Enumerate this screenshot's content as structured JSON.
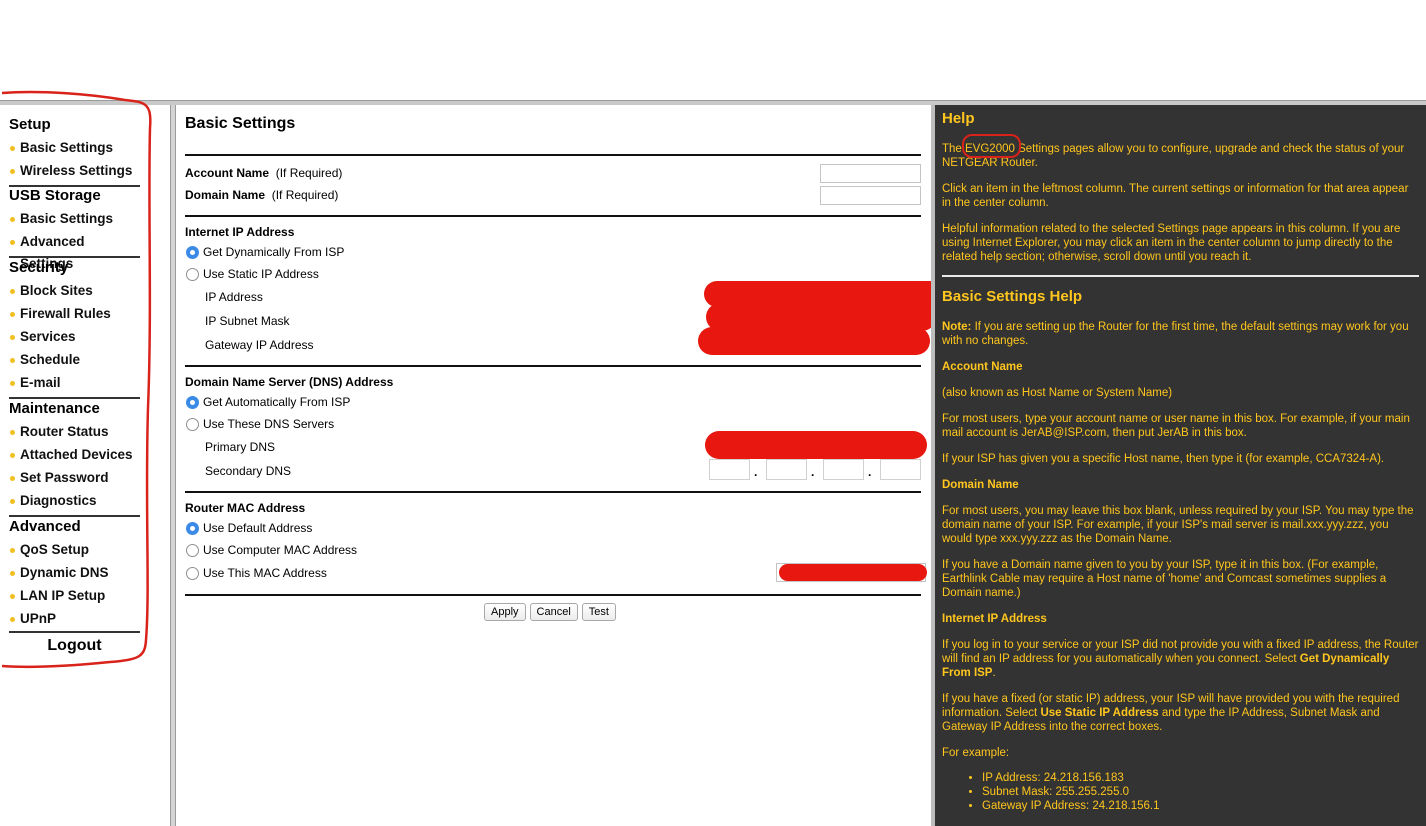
{
  "sidebar": {
    "groups": [
      {
        "heading": "Setup",
        "items": [
          "Basic Settings",
          "Wireless Settings"
        ]
      },
      {
        "heading": "USB Storage",
        "items": [
          "Basic Settings",
          "Advanced Settings"
        ]
      },
      {
        "heading": "Security",
        "items": [
          "Block Sites",
          "Firewall Rules",
          "Services",
          "Schedule",
          "E-mail"
        ]
      },
      {
        "heading": "Maintenance",
        "items": [
          "Router Status",
          "Attached Devices",
          "Set Password",
          "Diagnostics"
        ]
      },
      {
        "heading": "Advanced",
        "items": [
          "QoS Setup",
          "Dynamic DNS",
          "LAN IP Setup",
          "UPnP"
        ]
      }
    ],
    "logout": "Logout"
  },
  "main": {
    "title": "Basic Settings",
    "account_name_label": "Account Name",
    "account_name_hint": "(If Required)",
    "account_name_value": "",
    "domain_name_label": "Domain Name",
    "domain_name_hint": "(If Required)",
    "domain_name_value": "",
    "internet_ip": {
      "heading": "Internet IP Address",
      "opt_dynamic": "Get Dynamically From ISP",
      "opt_static": "Use Static IP Address",
      "ip_label": "IP Address",
      "subnet_label": "IP Subnet Mask",
      "gateway_label": "Gateway IP Address",
      "selected": "dynamic"
    },
    "dns": {
      "heading": "Domain Name Server (DNS) Address",
      "opt_auto": "Get Automatically From ISP",
      "opt_manual": "Use These DNS Servers",
      "primary_label": "Primary DNS",
      "secondary_label": "Secondary DNS",
      "separator": ".",
      "selected": "auto"
    },
    "mac": {
      "heading": "Router MAC Address",
      "opt_default": "Use Default Address",
      "opt_computer": "Use Computer MAC Address",
      "opt_this": "Use This MAC Address",
      "selected": "default"
    },
    "buttons": {
      "apply": "Apply",
      "cancel": "Cancel",
      "test": "Test"
    }
  },
  "help": {
    "title": "Help",
    "intro_pre": "The ",
    "intro_model": "EVG2000",
    "intro_post": " Settings pages allow you to configure, upgrade and check the status of your NETGEAR Router.",
    "p2": "Click an item in the leftmost column. The current settings or information for that area appear in the center column.",
    "p3": "Helpful information related to the selected Settings page appears in this column. If you are using Internet Explorer, you may click an item in the center column to jump directly to the related help section; otherwise, scroll down until you reach it.",
    "section_title": "Basic Settings Help",
    "note_label": "Note:",
    "note_text": " If you are setting up the Router for the first time, the default settings may work for you with no changes.",
    "account_heading": "Account Name",
    "account_p1": "(also known as Host Name or System Name)",
    "account_p2": "For most users, type your account name or user name in this box. For example, if your main mail account is JerAB@ISP.com, then put JerAB in this box.",
    "account_p3": "If your ISP has given you a specific Host name, then type it (for example, CCA7324-A).",
    "domain_heading": "Domain Name",
    "domain_p1": "For most users, you may leave this box blank, unless required by your ISP. You may type the domain name of your ISP. For example, if your ISP's mail server is mail.xxx.yyy.zzz, you would type xxx.yyy.zzz as the Domain Name.",
    "domain_p2": "If you have a Domain name given to you by your ISP, type it in this box. (For example, Earthlink Cable may require a Host name of 'home' and Comcast sometimes supplies a Domain name.)",
    "ip_heading": "Internet IP Address",
    "ip_p1_pre": "If you log in to your service or your ISP did not provide you with a fixed IP address, the Router will find an IP address for you automatically when you connect. Select ",
    "ip_p1_bold": "Get Dynamically From ISP",
    "ip_p1_post": ".",
    "ip_p2_pre": "If you have a fixed (or static IP) address, your ISP will have provided you with the required information. Select ",
    "ip_p2_bold": "Use Static IP Address",
    "ip_p2_post": " and type the IP Address, Subnet Mask and Gateway IP Address into the correct boxes.",
    "example_label": "For example:",
    "examples": [
      "IP Address: 24.218.156.183",
      "Subnet Mask: 255.255.255.0",
      "Gateway IP Address: 24.218.156.1"
    ]
  },
  "colors": {
    "help_bg": "#333333",
    "help_text": "#ffc61e",
    "redaction": "#e8170f",
    "bullet": "#f0c020"
  }
}
